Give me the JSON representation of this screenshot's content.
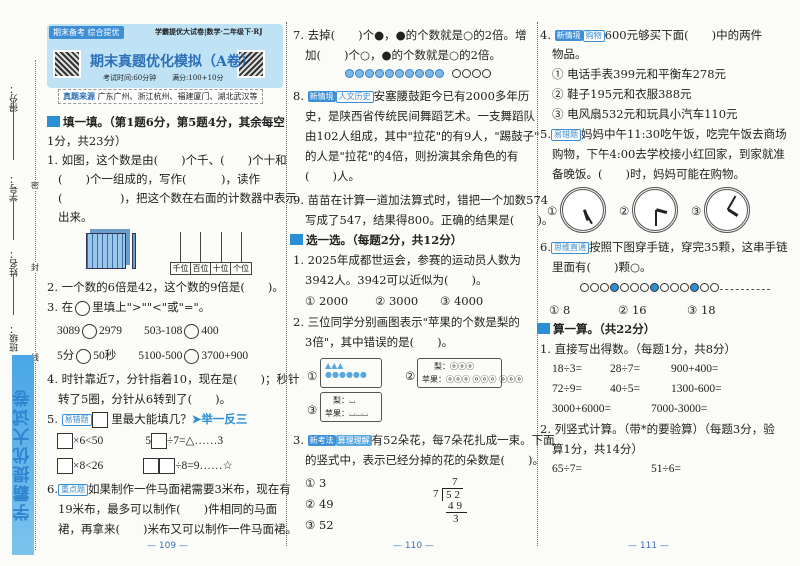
{
  "margin": {
    "labels": [
      "得分：",
      "学号：",
      "姓名：",
      "班级："
    ],
    "seal": [
      "密",
      "封",
      "线"
    ],
    "strip": "学霸提优大试卷"
  },
  "header": {
    "tag": "期末备考 综合提优",
    "series": "学霸提优大试卷|数学·二年级下·RJ",
    "title": "期末真题优化模拟（A卷）",
    "time": "考试时间:60分钟",
    "score": "满分:100+10分",
    "source_label": "真题来源",
    "source": "广东广州、浙江杭州、福建厦门、湖北武汉等"
  },
  "col1": {
    "sec1": "填一填。（第1题6分，第5题4分，其余每空",
    "sec1b": "1分，共23分）",
    "q1": [
      "1. 如图，这个数是由(　　)个千、(　　)个十和",
      "(　　)个一组成的，写作(　　　)，读作",
      "(　　　　　)，把这个数在右面的计数器中表示",
      "出来。"
    ],
    "counter": [
      "千位",
      "百位",
      "十位",
      "个位"
    ],
    "q2": "2. 一个数的6倍是42，这个数的9倍是(　　)。",
    "q3": "3. 在",
    "q3b": "里填上\">\"\"<\"或\"=\"。",
    "q3r": [
      [
        "3089",
        "2979",
        "503-108",
        "400"
      ],
      [
        "5分",
        "50秒",
        "5100-500",
        "3700+900"
      ]
    ],
    "q4": [
      "4. 时针靠近7，分针指着10，现在是(　　)；秒针",
      "转了5圈，分针从6转到了(　　)。"
    ],
    "q5": "5.",
    "q5tag": "易错题",
    "q5t": "里最大能填几？",
    "q5link": "➤举一反三",
    "q5r": [
      [
        "×6<50",
        "5",
        "÷7=△……3"
      ],
      [
        "×8<26",
        "÷8=9……☆"
      ]
    ],
    "q6tag": "重点题",
    "q6": [
      "6.",
      "如果制作一件马面裙需要3米布，现在有",
      "19米布，最多可以制作(　　)件相同的马面",
      "裙，再拿来(　　)米布又可以制作一件马面裙。"
    ],
    "page": "— 109 —"
  },
  "col2": {
    "q7": [
      "7. 去掉(　　)个●，●的个数就是○的2倍。增",
      "加(　　)个○，●的个数就是○的2倍。"
    ],
    "q8tag": [
      "新情境",
      "人文历史"
    ],
    "q8": [
      "8.",
      "安塞腰鼓距今已有2000多年历",
      "史，是陕西省传统民间舞蹈艺术。一支舞蹈队",
      "由102人组成，其中\"拉花\"的有9人，\"踢鼓子\"",
      "的人是\"拉花\"的4倍，则扮演其余角色的有",
      "(　　)人。"
    ],
    "q9": [
      "9. 苗苗在计算一道加法算式时，错把一个加数574",
      "写成了547，结果得800。正确的结果是(　　)。"
    ],
    "sec2": "选一选。（每题2分，共12分）",
    "c1": [
      "1. 2025年成都世运会，参赛的运动员人数为",
      "3942人。3942可以近似为(　　)。"
    ],
    "c1o": [
      "① 2000",
      "② 3000",
      "③ 4000"
    ],
    "c2": [
      "2. 三位同学分别画图表示\"苹果的个数是梨的",
      "3倍\"，其中错误的是(　　)。"
    ],
    "c2pics": {
      "n1": "①",
      "n2": "②",
      "n3": "③",
      "pear": "梨：",
      "apple": "苹果："
    },
    "c3tag": [
      "新考法",
      "算理理解"
    ],
    "c3": [
      "3.",
      "有52朵花，每7朵花扎成一束。下面",
      "的竖式中，表示已经分掉的花的朵数是(　　)。"
    ],
    "c3o": [
      "① 3",
      "② 49",
      "③ 52"
    ],
    "div": {
      "q": "7",
      "d": "7",
      "n": "52",
      "p": "49",
      "r": "3"
    },
    "page": "— 110 —"
  },
  "col3": {
    "c4tag": [
      "新情境",
      "购物"
    ],
    "c4": [
      "4.",
      "600元够买下面(　　)中的两件",
      "物品。"
    ],
    "c4o": [
      "① 电话手表399元和平衡车278元",
      "② 鞋子195元和衣服388元",
      "③ 电风扇532元和玩具小汽车110元"
    ],
    "c5tag": "易错题",
    "c5": [
      "5.",
      "妈妈中午11:30吃午饭，吃完午饭去商场",
      "购物，下午4:00去学校接小红回家，到家就准",
      "备晚饭。(　　)时，妈妈可能在购物。"
    ],
    "clocks": [
      {
        "n": "①",
        "h": 5,
        "m": 25
      },
      {
        "n": "②",
        "h": 3,
        "m": 30
      },
      {
        "n": "③",
        "h": 4,
        "m": 5
      }
    ],
    "c6tag": "思维直通",
    "c6": [
      "6.",
      "按照下图穿手链，穿完35颗，这串手链",
      "里面有(　　)颗○。"
    ],
    "c6o": [
      "① 8",
      "② 16",
      "③ 18"
    ],
    "sec3": "算一算。（共22分）",
    "s1": "1. 直接写出得数。（每题1分，共8分）",
    "s1r": [
      [
        "18÷3=",
        "28÷7=",
        "900+400="
      ],
      [
        "72÷9=",
        "40÷5=",
        "1300-600="
      ],
      [
        "3000+6000=",
        "7000-3000="
      ]
    ],
    "s2": [
      "2. 列竖式计算。（带*的要验算）（每题3分，验",
      "算1分，共14分）"
    ],
    "s2r": [
      "65÷7=",
      "51÷6="
    ],
    "page": "— 111 —"
  },
  "colors": {
    "accent": "#2b8fd6",
    "header_bg": "#bfe3f5"
  }
}
